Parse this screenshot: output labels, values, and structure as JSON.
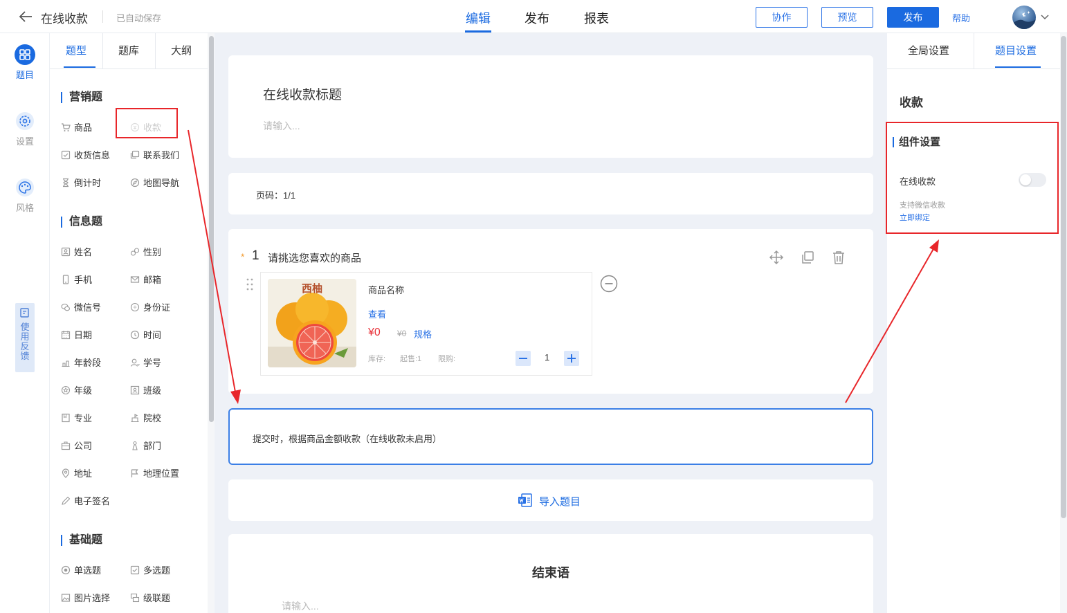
{
  "header": {
    "title": "在线收款",
    "autosave": "已自动保存",
    "tabs": [
      "编辑",
      "发布",
      "报表"
    ],
    "collab": "协作",
    "preview": "预览",
    "publish": "发布",
    "help": "帮助"
  },
  "rail": {
    "items": [
      "题目",
      "设置",
      "风格"
    ],
    "feedback": "使用反馈"
  },
  "qpanel": {
    "tabs": [
      "题型",
      "题库",
      "大纲"
    ],
    "sections": {
      "marketing": "营销题",
      "info": "信息题",
      "basic": "基础题"
    },
    "marketing_items": [
      "商品",
      "收款",
      "收货信息",
      "联系我们",
      "倒计时",
      "地图导航"
    ],
    "info_items": [
      "姓名",
      "性别",
      "手机",
      "邮箱",
      "微信号",
      "身份证",
      "日期",
      "时间",
      "年龄段",
      "学号",
      "年级",
      "班级",
      "专业",
      "院校",
      "公司",
      "部门",
      "地址",
      "地理位置",
      "电子签名"
    ],
    "basic_items": [
      "单选题",
      "多选题",
      "图片选择",
      "级联题"
    ]
  },
  "canvas": {
    "survey_title": "在线收款标题",
    "survey_desc_placeholder": "请输入...",
    "page_label": "页码：1/1",
    "question": {
      "required_mark": "*",
      "number": "1",
      "text": "请挑选您喜欢的商品",
      "product": {
        "image_label": "西柚",
        "name": "商品名称",
        "view": "查看",
        "price": "¥0",
        "old_price": "¥0",
        "spec": "规格",
        "stock": "库存:",
        "min_sale": "起售:1",
        "limit": "限购:",
        "quantity": "1"
      }
    },
    "payment_note": "提交时，根据商品金额收款（在线收款未启用）",
    "import_label": "导入题目",
    "ending_title": "结束语",
    "ending_placeholder": "请输入..."
  },
  "rpanel": {
    "tabs": [
      "全局设置",
      "题目设置"
    ],
    "heading": "收款",
    "component_title": "组件设置",
    "online_payment_label": "在线收款",
    "online_payment_enabled": false,
    "hint": "支持微信收款",
    "bind_link": "立即绑定"
  },
  "colors": {
    "accent": "#1a6ae0",
    "annotation": "#e8262a",
    "price": "#e8323a"
  }
}
